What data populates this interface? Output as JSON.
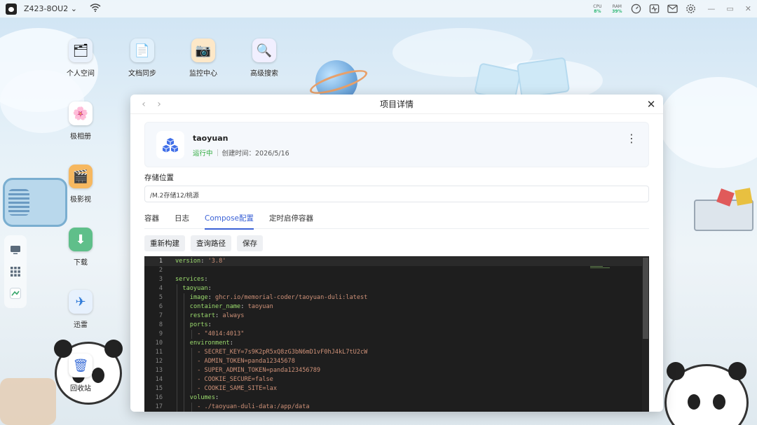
{
  "topbar": {
    "device_name": "Z423-8OU2",
    "cpu_label": "CPU",
    "cpu_value": "8%",
    "ram_label": "RAM",
    "ram_value": "39%"
  },
  "desktop_icons": [
    {
      "label": "个人空间",
      "icon": "person-folder-icon"
    },
    {
      "label": "文档同步",
      "icon": "doc-sync-icon"
    },
    {
      "label": "监控中心",
      "icon": "camera-icon"
    },
    {
      "label": "高级搜索",
      "icon": "search-icon"
    },
    {
      "label": "极相册",
      "icon": "photo-icon"
    },
    {
      "label": "极影视",
      "icon": "video-icon"
    },
    {
      "label": "下载",
      "icon": "download-icon"
    },
    {
      "label": "迅雷",
      "icon": "thunder-icon"
    },
    {
      "label": "回收站",
      "icon": "trash-icon"
    }
  ],
  "window": {
    "title": "项目详情",
    "project": {
      "name": "taoyuan",
      "status": "运行中",
      "created": "创建时间：2026/5/16"
    },
    "storage_label": "存储位置",
    "storage_path": "/M.2存储12/桃源",
    "tabs": [
      "容器",
      "日志",
      "Compose配置",
      "定时启停容器"
    ],
    "active_tab": "Compose配置",
    "buttons": {
      "rebuild": "重新构建",
      "query_path": "查询路径",
      "save": "保存"
    },
    "code_lines": [
      {
        "n": "1",
        "indent": 0,
        "key": "version",
        "val": "'3.8'"
      },
      {
        "n": "2",
        "indent": 0,
        "key": "",
        "val": ""
      },
      {
        "n": "3",
        "indent": 0,
        "key": "services",
        "val": ""
      },
      {
        "n": "4",
        "indent": 1,
        "key": "taoyuan",
        "val": ""
      },
      {
        "n": "5",
        "indent": 2,
        "key": "image",
        "val": "ghcr.io/memorial-coder/taoyuan-duli:latest"
      },
      {
        "n": "6",
        "indent": 2,
        "key": "container_name",
        "val": "taoyuan"
      },
      {
        "n": "7",
        "indent": 2,
        "key": "restart",
        "val": "always"
      },
      {
        "n": "8",
        "indent": 2,
        "key": "ports",
        "val": ""
      },
      {
        "n": "9",
        "indent": 3,
        "key": "",
        "val": "- \"4014:4013\""
      },
      {
        "n": "10",
        "indent": 2,
        "key": "environment",
        "val": ""
      },
      {
        "n": "11",
        "indent": 3,
        "key": "",
        "val": "- SECRET_KEY=7s9K2pR5xQ8zG3bN6mD1vF0hJ4kL7tU2cW"
      },
      {
        "n": "12",
        "indent": 3,
        "key": "",
        "val": "- ADMIN_TOKEN=panda12345678"
      },
      {
        "n": "13",
        "indent": 3,
        "key": "",
        "val": "- SUPER_ADMIN_TOKEN=panda123456789"
      },
      {
        "n": "14",
        "indent": 3,
        "key": "",
        "val": "- COOKIE_SECURE=false"
      },
      {
        "n": "15",
        "indent": 3,
        "key": "",
        "val": "- COOKIE_SAME_SITE=lax"
      },
      {
        "n": "16",
        "indent": 2,
        "key": "volumes",
        "val": ""
      },
      {
        "n": "17",
        "indent": 3,
        "key": "",
        "val": "- ./taoyuan-duli-data:/app/data"
      }
    ]
  }
}
